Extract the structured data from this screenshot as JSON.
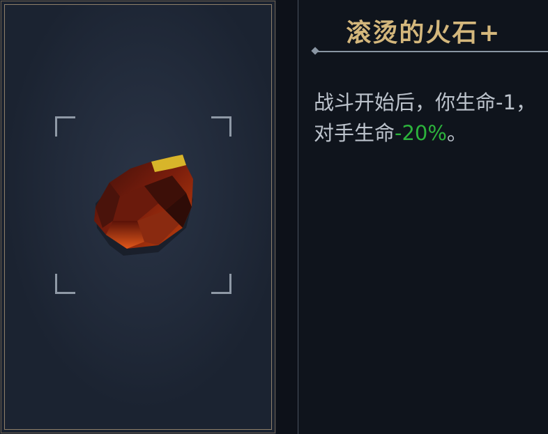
{
  "item": {
    "name": "滚烫的火石+",
    "icon": "hot-flint-icon",
    "description": {
      "prefix": "战斗开始后，你生命-1，对手生命",
      "highlight": "-20%",
      "suffix": "。"
    }
  },
  "colors": {
    "title": "#d4b77c",
    "description": "#bcc3cc",
    "highlight": "#2cb33c",
    "card_border": "#8f806a"
  }
}
